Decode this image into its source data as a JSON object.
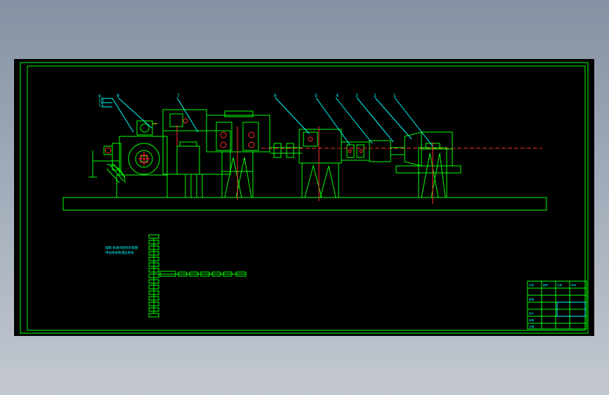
{
  "drawing": {
    "part_numbers": [
      "9",
      "10",
      "11",
      "8",
      "7",
      "6",
      "5",
      "4",
      "3",
      "2",
      "1"
    ],
    "notes": [
      "摆管 机组的结构示意图",
      "传动系统和液压系统"
    ],
    "title_block": {
      "cells": [
        "名称",
        "图号",
        "比例",
        "材料",
        "重量",
        "设计",
        "审核",
        "日期"
      ]
    },
    "colors": {
      "background": "#000000",
      "outline": "#00ff00",
      "annotation": "#00ffff",
      "centerline": "#ff3030"
    }
  }
}
